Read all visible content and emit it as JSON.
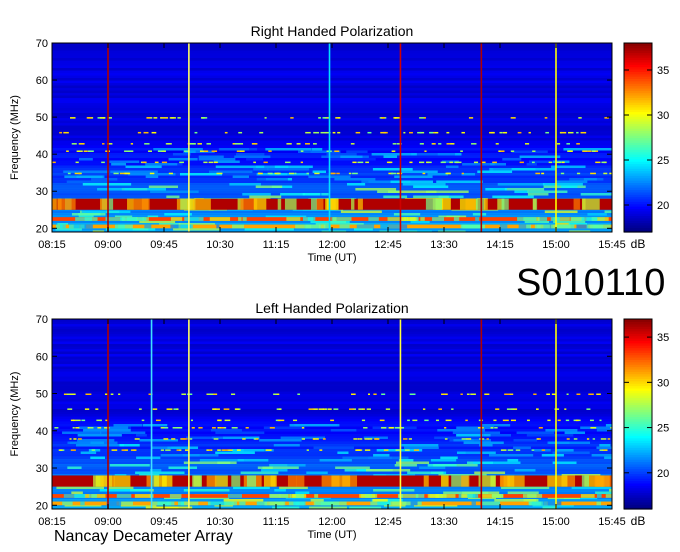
{
  "header_id": "S010110",
  "footer": "Nancay Decameter Array",
  "chart_data": [
    {
      "type": "heatmap",
      "title": "Right Handed Polarization",
      "xlabel": "Time (UT)",
      "ylabel": "Frequency (MHz)",
      "x_ticks": [
        "08:15",
        "09:00",
        "09:45",
        "10:30",
        "11:15",
        "12:00",
        "12:45",
        "13:30",
        "14:15",
        "15:00",
        "15:45"
      ],
      "y_ticks": [
        20,
        30,
        40,
        50,
        60,
        70
      ],
      "ylim": [
        19,
        70
      ],
      "colorbar_label": "dB",
      "colorbar_ticks": [
        20,
        25,
        30,
        35
      ],
      "colorbar_range": [
        17,
        38
      ],
      "colormap": [
        "#00007f",
        "#0000ff",
        "#007fff",
        "#00ffff",
        "#7fff7f",
        "#ffff00",
        "#ff7f00",
        "#ff0000",
        "#7f0000"
      ],
      "background_level_db": 19,
      "intense_bands_mhz": [
        {
          "low": 25,
          "high": 28,
          "level_db": 37
        },
        {
          "low": 22,
          "high": 23,
          "level_db": 34
        },
        {
          "low": 20,
          "high": 21,
          "level_db": 32
        }
      ],
      "vertical_markers": [
        {
          "time": "09:00",
          "color": "#b00000"
        },
        {
          "time": "10:05",
          "color": "#ffff60"
        },
        {
          "time": "11:58",
          "color": "#00e0ff"
        },
        {
          "time": "12:55",
          "color": "#d00000"
        },
        {
          "time": "14:00",
          "color": "#b00000"
        },
        {
          "time": "15:00",
          "color": "#ffff00"
        }
      ]
    },
    {
      "type": "heatmap",
      "title": "Left Handed Polarization",
      "xlabel": "Time (UT)",
      "ylabel": "Frequency (MHz)",
      "x_ticks": [
        "08:15",
        "09:00",
        "09:45",
        "10:30",
        "11:15",
        "12:00",
        "12:45",
        "13:30",
        "14:15",
        "15:00",
        "15:45"
      ],
      "y_ticks": [
        20,
        30,
        40,
        50,
        60,
        70
      ],
      "ylim": [
        19,
        70
      ],
      "colorbar_label": "dB",
      "colorbar_ticks": [
        20,
        25,
        30,
        35
      ],
      "colorbar_range": [
        16,
        37
      ],
      "colormap": [
        "#00007f",
        "#0000ff",
        "#007fff",
        "#00ffff",
        "#7fff7f",
        "#ffff00",
        "#ff7f00",
        "#ff0000",
        "#7f0000"
      ],
      "background_level_db": 18,
      "intense_bands_mhz": [
        {
          "low": 25,
          "high": 28,
          "level_db": 36
        },
        {
          "low": 22,
          "high": 23,
          "level_db": 33
        },
        {
          "low": 20,
          "high": 21,
          "level_db": 31
        }
      ],
      "vertical_markers": [
        {
          "time": "09:00",
          "color": "#b00000"
        },
        {
          "time": "09:35",
          "color": "#40e0ff"
        },
        {
          "time": "10:05",
          "color": "#ffff60"
        },
        {
          "time": "12:55",
          "color": "#ffff40"
        },
        {
          "time": "14:00",
          "color": "#b00000"
        },
        {
          "time": "15:00",
          "color": "#ffff00"
        }
      ]
    }
  ]
}
